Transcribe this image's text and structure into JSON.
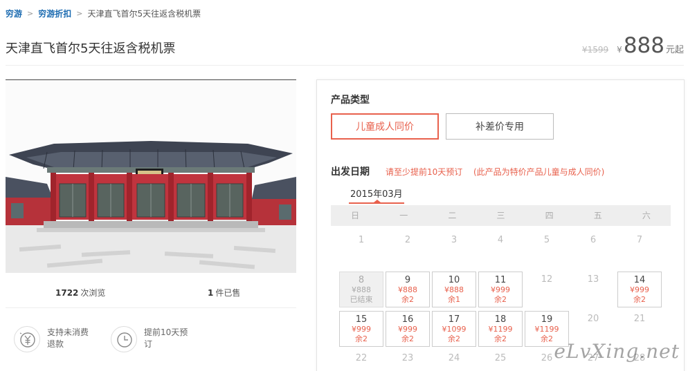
{
  "breadcrumb": {
    "items": [
      "穷游",
      "穷游折扣"
    ],
    "current": "天津直飞首尔5天往返含税机票",
    "separator": ">"
  },
  "product": {
    "title": "天津直飞首尔5天往返含税机票",
    "old_price": "¥1599",
    "currency": "¥",
    "price": "888",
    "price_suffix": "元起"
  },
  "stats": {
    "views_num": "1722",
    "views_label": "次浏览",
    "sold_num": "1",
    "sold_label": "件已售"
  },
  "features": [
    {
      "icon": "yuan-refund-icon",
      "text": "支持未消费退款"
    },
    {
      "icon": "clock-icon",
      "text": "提前10天预订"
    }
  ],
  "panel": {
    "type_title": "产品类型",
    "types": [
      {
        "label": "儿童成人同价",
        "selected": true
      },
      {
        "label": "补差价专用",
        "selected": false
      }
    ],
    "date_title": "出发日期",
    "note1": "请至少提前10天预订",
    "note2": "(此产品为特价产品儿童与成人同价)",
    "month": "2015年03月",
    "weekdays": [
      "日",
      "一",
      "二",
      "三",
      "四",
      "五",
      "六"
    ]
  },
  "calendar": {
    "row0": [
      "1",
      "2",
      "3",
      "4",
      "5",
      "6",
      "7"
    ],
    "r1": {
      "d8": "8",
      "p8": "¥888",
      "r8": "已结束",
      "d9": "9",
      "p9": "¥888",
      "r9": "余2",
      "d10": "10",
      "p10": "¥888",
      "r10": "余1",
      "d11": "11",
      "p11": "¥999",
      "r11": "余2",
      "d12": "12",
      "d13": "13",
      "d14": "14",
      "p14": "¥999",
      "r14": "余2"
    },
    "r2": {
      "d15": "15",
      "p15": "¥999",
      "r15": "余2",
      "d16": "16",
      "p16": "¥999",
      "r16": "余2",
      "d17": "17",
      "p17": "¥1099",
      "r17": "余2",
      "d18": "18",
      "p18": "¥1199",
      "r18": "余2",
      "d19": "19",
      "p19": "¥1199",
      "r19": "余2",
      "d20": "20",
      "d21": "21"
    },
    "row3": [
      "22",
      "23",
      "24",
      "25",
      "26",
      "27",
      "28"
    ]
  },
  "watermark": "eLvXing.net",
  "colors": {
    "accent": "#e8604c",
    "link": "#1a6ab0"
  }
}
